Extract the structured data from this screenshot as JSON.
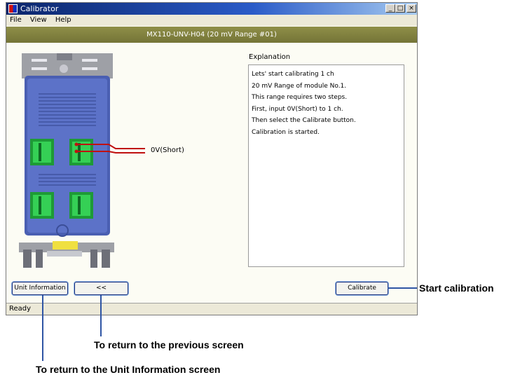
{
  "window": {
    "title": "Calibrator",
    "controls": [
      "_",
      "□",
      "×"
    ]
  },
  "menu": [
    "File",
    "View",
    "Help"
  ],
  "header": {
    "module_title": "MX110-UNV-H04 (20 mV Range #01)"
  },
  "explanation": {
    "label": "Explanation",
    "lines": [
      "Lets' start calibrating 1 ch",
      "20 mV Range of module No.1.",
      "This range requires two steps.",
      "First, input 0V(Short) to 1 ch.",
      "Then select the Calibrate button.",
      "Calibration is started."
    ]
  },
  "diagram": {
    "input_label": "0V(Short)"
  },
  "buttons": {
    "unit_information": "Unit Information",
    "back": "<<",
    "calibrate": "Calibrate"
  },
  "status": {
    "text": "Ready"
  },
  "callouts": {
    "start": "Start calibration",
    "previous": "To return to the previous screen",
    "unit_info": "To return to the Unit Information screen"
  },
  "colors": {
    "title_bar": "#0a246a",
    "header_band": "#7f7f3e",
    "module_body": "#4a5fb2",
    "terminal_green": "#2fc04a",
    "callout_line": "#2f55a4",
    "wire": "#c01010"
  }
}
